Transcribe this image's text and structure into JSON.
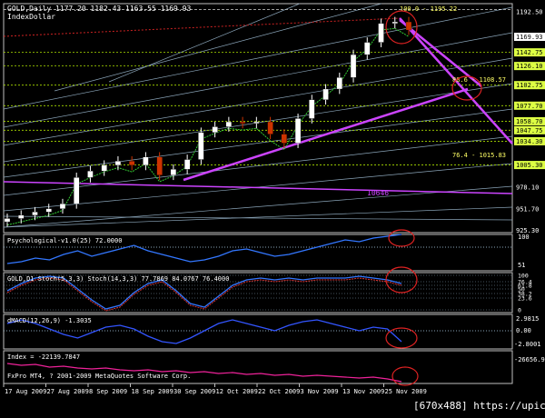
{
  "header": {
    "symbol_line": "GOLD,Daily  1177.20 1182.43 1163.55 1169.93",
    "indicator_name": "IndexDollar"
  },
  "main": {
    "fib_labels": [
      "100.0 - 1195.22",
      "88.6 - 1108.57",
      "76.4 - 1015.83"
    ],
    "annotation": "10646",
    "price_ticks": [
      "1192.50",
      "1142.75",
      "1126.10",
      "1102.75",
      "1077.70",
      "1058.70",
      "1047.75",
      "1034.30",
      "1005.30",
      "978.10",
      "951.70",
      "925.30"
    ],
    "price_tick_values": [
      1192.5,
      1142.75,
      1126.1,
      1102.75,
      1077.7,
      1058.7,
      1047.75,
      1034.3,
      1005.3,
      978.1,
      951.7,
      925.3
    ],
    "current_price_box": "1169.93"
  },
  "psych": {
    "label": "Psychological-v1.0(25) 72.0000",
    "ticks": [
      "100",
      "51"
    ]
  },
  "stoch": {
    "label": "GOLD,D1 Stoch(5,3,3) Stoch(14,3,3) 77.7869 84.0767 76.4000",
    "ticks": [
      "100",
      "76.4",
      "61.8",
      "50",
      "38.2",
      "23.6",
      "0"
    ]
  },
  "macd": {
    "label": "dMACD(12,26,9) -1.3035",
    "ticks": [
      "2.9815",
      "0.00",
      "-2.8001"
    ]
  },
  "index": {
    "label": "Index = -22139.7847",
    "ticks": [
      "-26656.9"
    ]
  },
  "footer": {
    "copyright": "FxPro MT4, ? 2001-2009 MetaQuotes Software Corp.",
    "dates": [
      "17 Aug 2009",
      "27 Aug 2009",
      "8 Sep 2009",
      "18 Sep 2009",
      "30 Sep 2009",
      "12 Oct 2009",
      "22 Oct 2009",
      "3 Nov 2009",
      "13 Nov 2009",
      "25 Nov 2009"
    ],
    "watermark": "[670x488] https://upic.me/"
  },
  "colors": {
    "bull": "#ffffff",
    "bear": "#cc3300",
    "ma_green": "#33cc33",
    "trend_violet": "#cc44ff",
    "psych": "#3377ff",
    "grid": "#8aa4b8",
    "fib_dotted": "#aadd00",
    "circle": "#dd2222"
  },
  "chart_data": {
    "type": "candlestick",
    "title": "GOLD,Daily",
    "x": [
      "2009-08-17",
      "2009-08-20",
      "2009-08-24",
      "2009-08-27",
      "2009-09-01",
      "2009-09-04",
      "2009-09-08",
      "2009-09-11",
      "2009-09-15",
      "2009-09-18",
      "2009-09-22",
      "2009-09-25",
      "2009-09-30",
      "2009-10-03",
      "2009-10-07",
      "2009-10-12",
      "2009-10-15",
      "2009-10-19",
      "2009-10-22",
      "2009-10-26",
      "2009-10-29",
      "2009-11-03",
      "2009-11-06",
      "2009-11-10",
      "2009-11-13",
      "2009-11-17",
      "2009-11-20",
      "2009-11-25",
      "2009-11-27",
      "2009-12-01"
    ],
    "close": [
      940,
      944,
      948,
      952,
      958,
      990,
      998,
      1005,
      1010,
      1005,
      1015,
      993,
      1000,
      1012,
      1045,
      1052,
      1058,
      1056,
      1058,
      1043,
      1032,
      1062,
      1085,
      1098,
      1112,
      1140,
      1155,
      1178,
      1180,
      1170
    ],
    "ylim": [
      925,
      1200
    ],
    "price_axis": "right",
    "secondary_panels": [
      "Psychological",
      "Stoch",
      "dMACD",
      "Index"
    ]
  }
}
